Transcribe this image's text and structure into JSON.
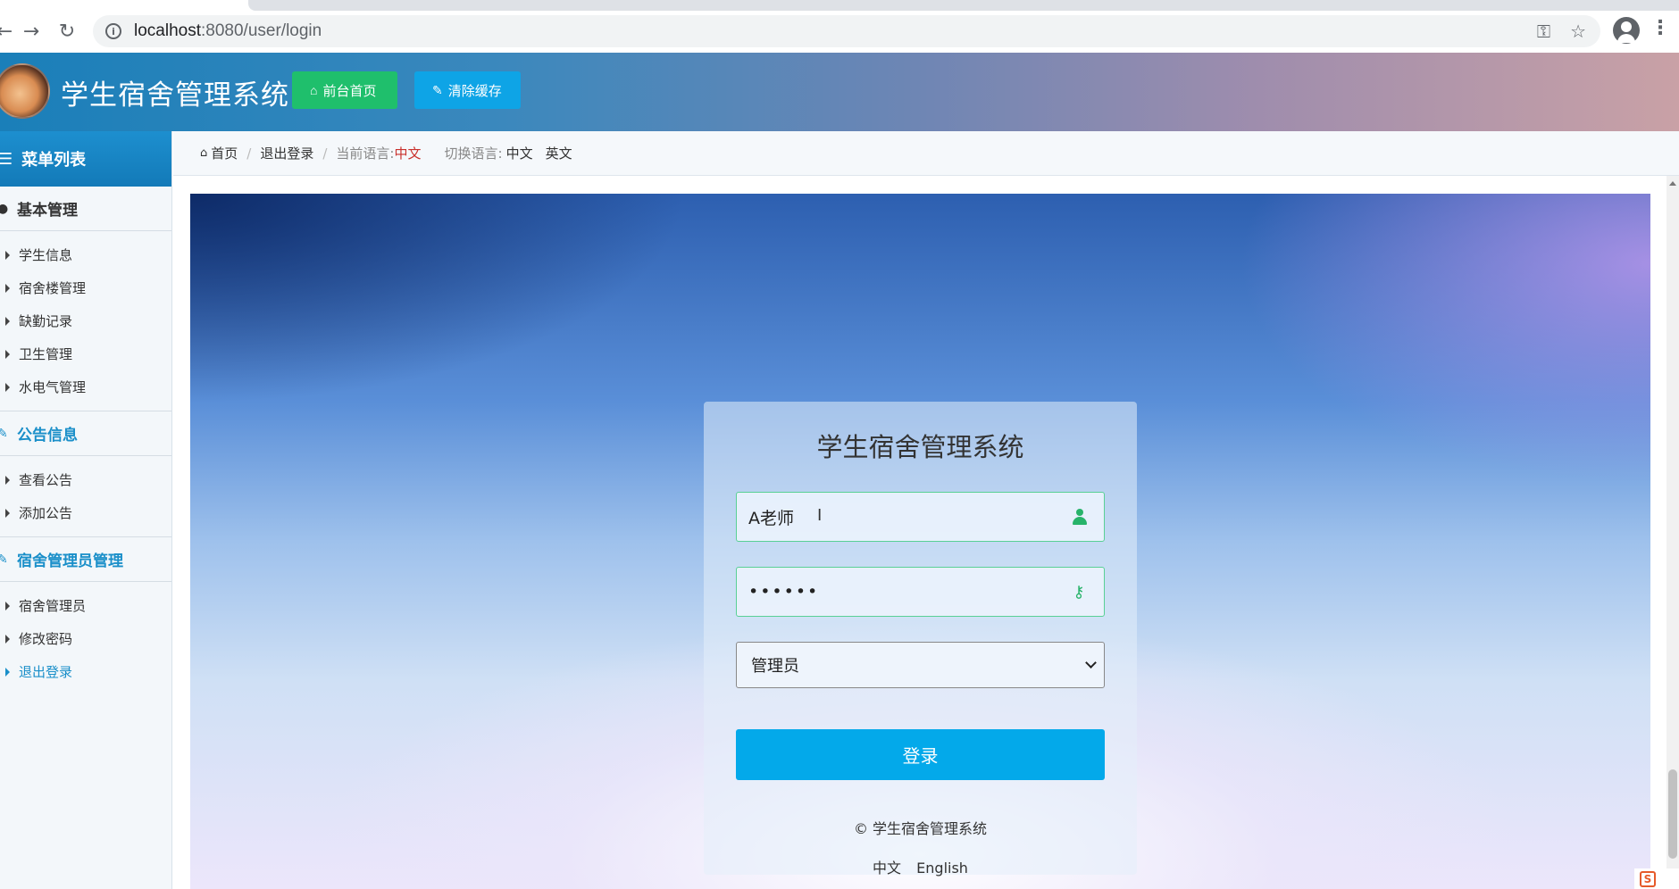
{
  "browser": {
    "url_host": "localhost",
    "url_path": ":8080/user/login"
  },
  "header": {
    "title": "学生宿舍管理系统",
    "home_label": "前台首页",
    "cache_label": "清除缓存"
  },
  "sidebar": {
    "title": "菜单列表",
    "groups": [
      {
        "title": "基本管理",
        "items": [
          "学生信息",
          "宿舍楼管理",
          "缺勤记录",
          "卫生管理",
          "水电气管理"
        ]
      },
      {
        "title": "公告信息",
        "items": [
          "查看公告",
          "添加公告"
        ]
      },
      {
        "title": "宿舍管理员管理",
        "items": [
          "宿舍管理员",
          "修改密码",
          "退出登录"
        ]
      }
    ]
  },
  "breadcrumb": {
    "home": "首页",
    "logout": "退出登录",
    "current_lang_label": "当前语言:",
    "current_lang": "中文",
    "switch_lang_label": "切换语言:",
    "lang_zh": "中文",
    "lang_en": "英文"
  },
  "login": {
    "title": "学生宿舍管理系统",
    "username": "A老师",
    "password_mask": "••••••",
    "role": "管理员",
    "submit": "登录",
    "copyright": "© 学生宿舍管理系统",
    "lang_zh": "中文",
    "lang_en": "English"
  },
  "colors": {
    "accent": "#03a9ea",
    "success": "#1fbf6c",
    "sidebar_active": "#1a8fc9"
  }
}
